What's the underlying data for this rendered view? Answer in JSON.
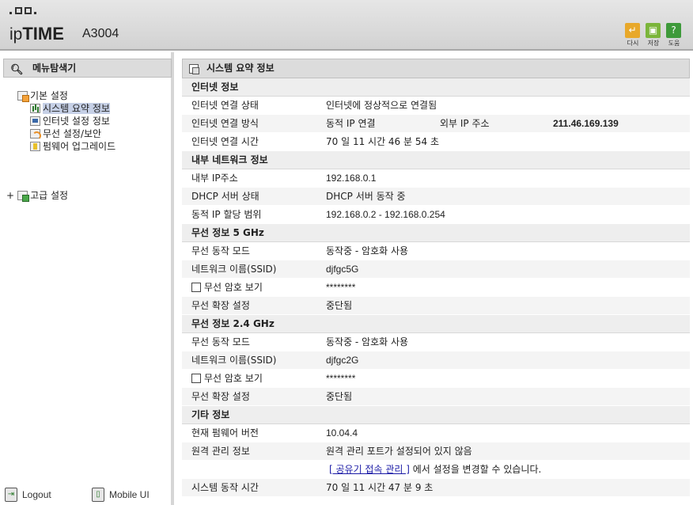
{
  "brand": {
    "logo": "ipTIME",
    "model": "A3004"
  },
  "toolbar": {
    "reload_label": "다시",
    "save_label": "저장",
    "help_label": "도움"
  },
  "sidebar": {
    "title": "메뉴탐색기",
    "tree": {
      "basic": "기본 설정",
      "items": [
        "시스템 요약 정보",
        "인터넷 설정 정보",
        "무선 설정/보안",
        "펌웨어 업그레이드"
      ],
      "advanced": "고급 설정"
    },
    "footer": {
      "logout": "Logout",
      "mobile": "Mobile UI"
    }
  },
  "main": {
    "title": "시스템 요약 정보",
    "internet": {
      "title": "인터넷 정보",
      "status_label": "인터넷 연결 상태",
      "status_value": "인터넷에 정상적으로 연결됨",
      "method_label": "인터넷 연결 방식",
      "method_value": "동적 IP 연결",
      "ext_ip_label": "외부 IP 주소",
      "ext_ip_value": "211.46.169.139",
      "time_label": "인터넷 연결 시간",
      "time_value": "70 일 11 시간 46 분 54 초"
    },
    "lan": {
      "title": "내부 네트워크 정보",
      "ip_label": "내부 IP주소",
      "ip_value": "192.168.0.1",
      "dhcp_label": "DHCP 서버 상태",
      "dhcp_value": "DHCP 서버 동작 중",
      "range_label": "동적 IP 할당 범위",
      "range_value": "192.168.0.2 -  192.168.0.254"
    },
    "wifi5": {
      "title": "무선 정보 5 GHz",
      "mode_label": "무선 동작 모드",
      "mode_value": "동작중 - 암호화 사용",
      "ssid_label": "네트워크 이름(SSID)",
      "ssid_value": "djfgc5G",
      "pw_label": "무선 암호 보기",
      "pw_value": "********",
      "ext_label": "무선 확장 설정",
      "ext_value": "중단됨"
    },
    "wifi24": {
      "title": "무선 정보 2.4 GHz",
      "mode_label": "무선 동작 모드",
      "mode_value": "동작중 - 암호화 사용",
      "ssid_label": "네트워크 이름(SSID)",
      "ssid_value": "djfgc2G",
      "pw_label": "무선 암호 보기",
      "pw_value": "********",
      "ext_label": "무선 확장 설정",
      "ext_value": "중단됨"
    },
    "etc": {
      "title": "기타 정보",
      "fw_label": "현재 펌웨어 버전",
      "fw_value": "10.04.4",
      "remote_label": "원격 관리 정보",
      "remote_value": "원격 관리 포트가 설정되어 있지 않음",
      "remote_link": "[ 공유기 접속 관리 ]",
      "remote_link_suffix": " 에서 설정을 변경할 수 있습니다.",
      "uptime_label": "시스템 동작 시간",
      "uptime_value": "70 일 11 시간 47 분 9 초"
    }
  }
}
